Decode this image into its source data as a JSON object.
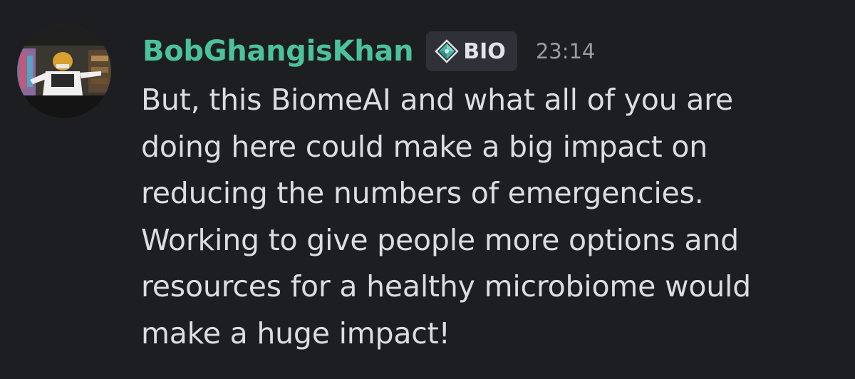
{
  "message": {
    "author": "BobGhangisKhan",
    "tag_label": "BIO",
    "tag_icon": "diamond-badge-icon",
    "timestamp": "23:14",
    "lines": [
      "But, this BiomeAI and what all of you are",
      "doing here could make a big impact on",
      "reducing the numbers of emergencies.",
      "Working to give people more options and",
      "resources for a healthy microbiome would",
      "make a huge impact!"
    ]
  },
  "colors": {
    "background": "#1d1e22",
    "username": "#4cc29a",
    "message_text": "#dcdde1",
    "timestamp": "#9a9ca4",
    "tag_background": "#2f3038"
  }
}
